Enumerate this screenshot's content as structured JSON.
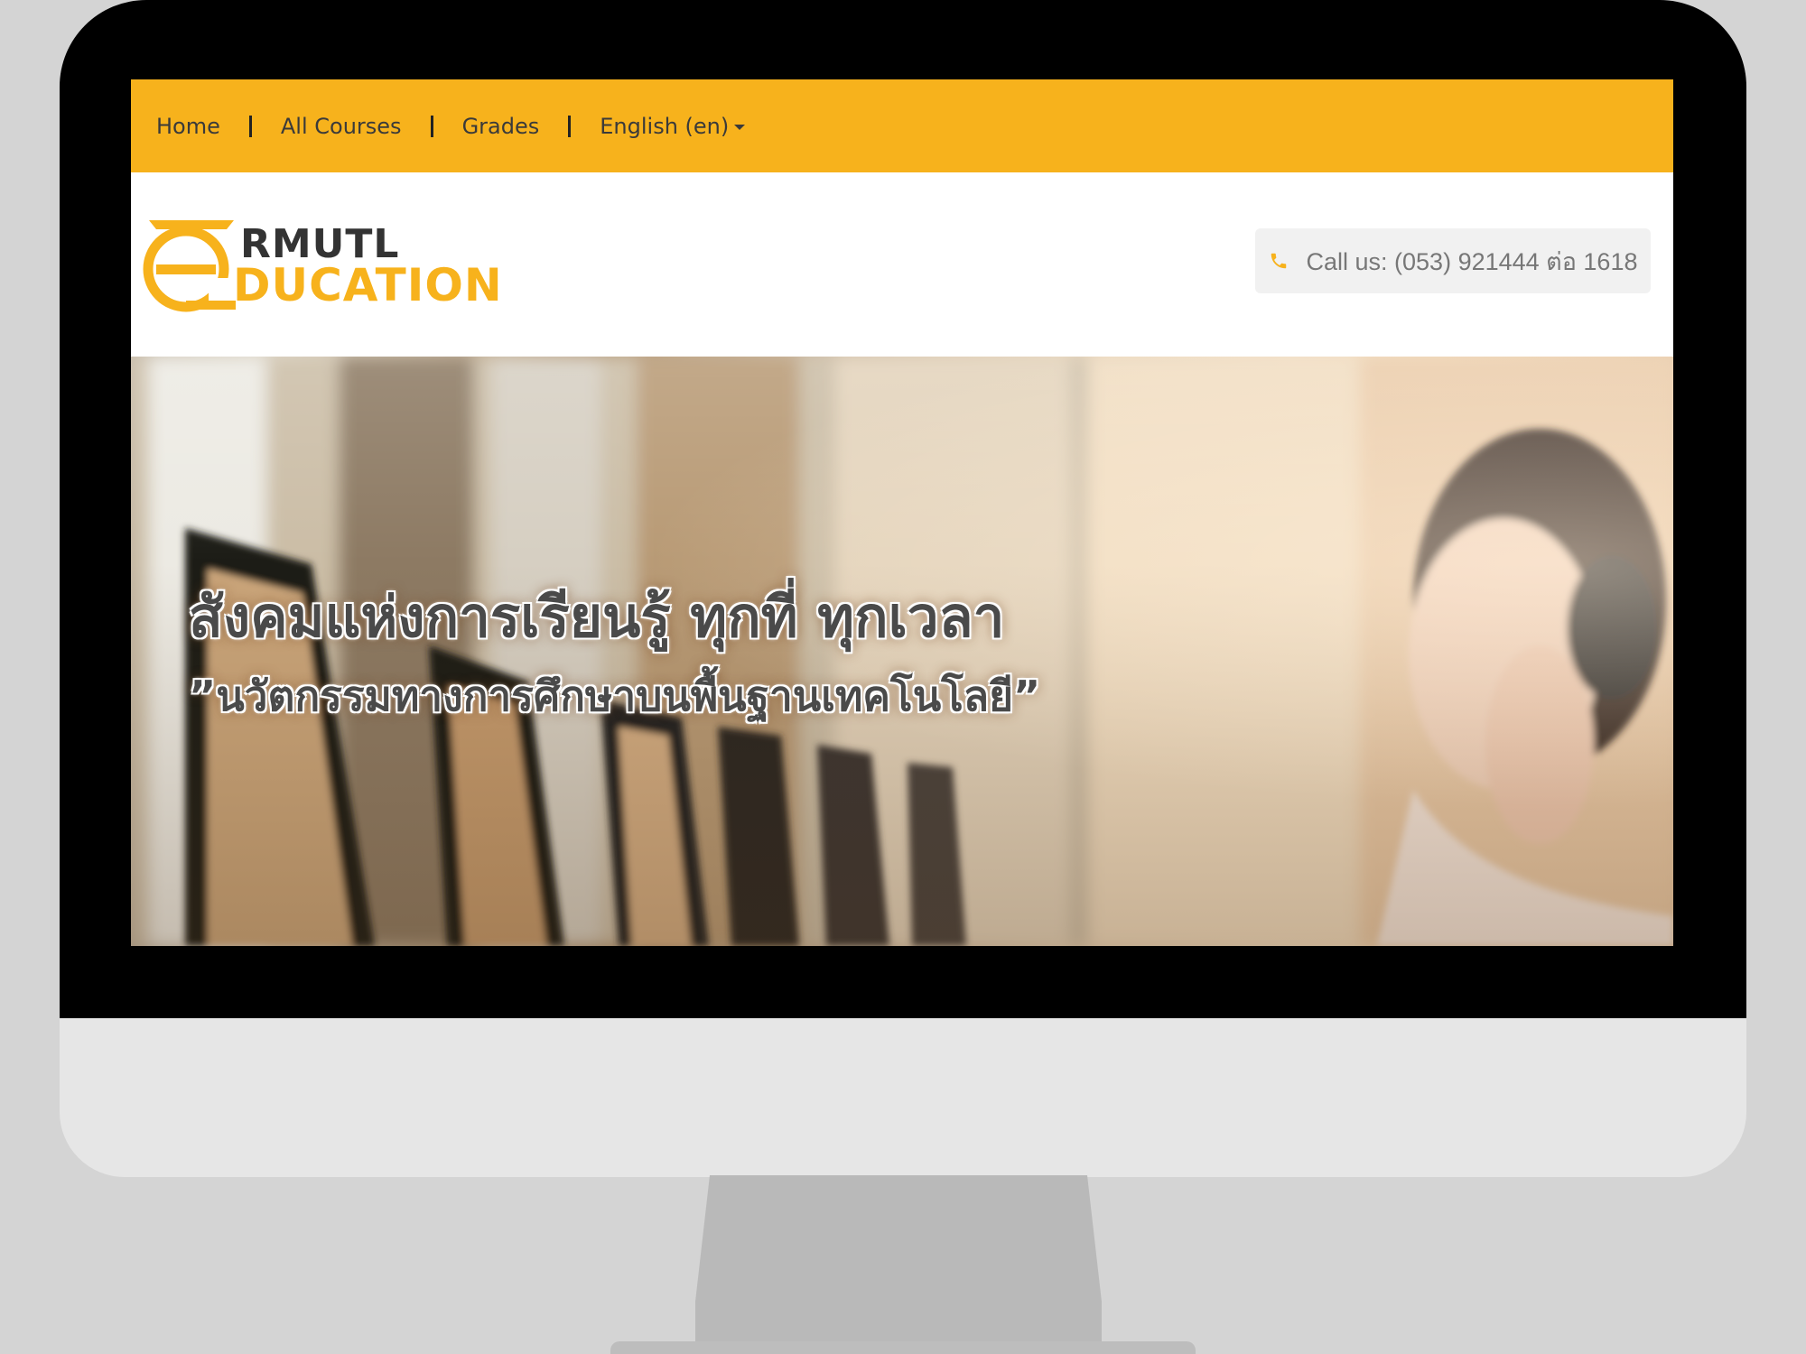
{
  "nav": {
    "items": [
      {
        "label": "Home"
      },
      {
        "label": "All Courses"
      },
      {
        "label": "Grades"
      },
      {
        "label": "English (en)"
      }
    ]
  },
  "logo": {
    "line1": "RMUTL",
    "line2": "DUCATION",
    "letter": "e"
  },
  "contact": {
    "text": "Call us: (053) 921444 ต่อ 1618"
  },
  "hero": {
    "headline": "สังคมแห่งการเรียนรู้ ทุกที่ ทุกเวลา",
    "subheadline": "”นวัตกรรมทางการศึกษาบนพื้นฐานเทคโนโลยี”"
  },
  "colors": {
    "accent": "#f7b21c",
    "monitor_bezel": "#000000",
    "monitor_body": "#e6e6e6",
    "background": "#d4d4d4"
  }
}
